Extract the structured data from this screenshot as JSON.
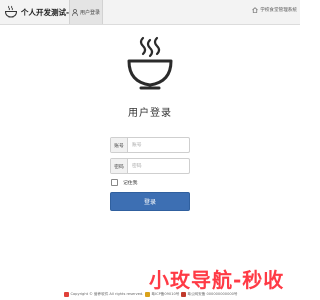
{
  "header": {
    "app_title": "个人开发测试--营养餐",
    "active_tab": "用户登录",
    "right_link": "学校食堂管理系统"
  },
  "login": {
    "title": "用户登录",
    "account_label": "账号",
    "account_placeholder": "账号",
    "password_label": "密码",
    "password_placeholder": "密码",
    "remember_label": "记住我",
    "submit_label": "登录"
  },
  "watermark": "小玫导航-秒收",
  "footer": {
    "copyright": "Copyright © 营养软件 All rights reserved.",
    "icp": "粤ICP备09010号",
    "police": "粤公网安备 000000000000号"
  },
  "colors": {
    "primary_button": "#3d6fb3",
    "watermark": "#ff3a45",
    "navbar_bg": "#f3f3f3"
  },
  "icons": [
    "bowl-logo-icon",
    "user-icon",
    "home-icon",
    "steaming-bowl-icon",
    "footer-badge-icon"
  ]
}
